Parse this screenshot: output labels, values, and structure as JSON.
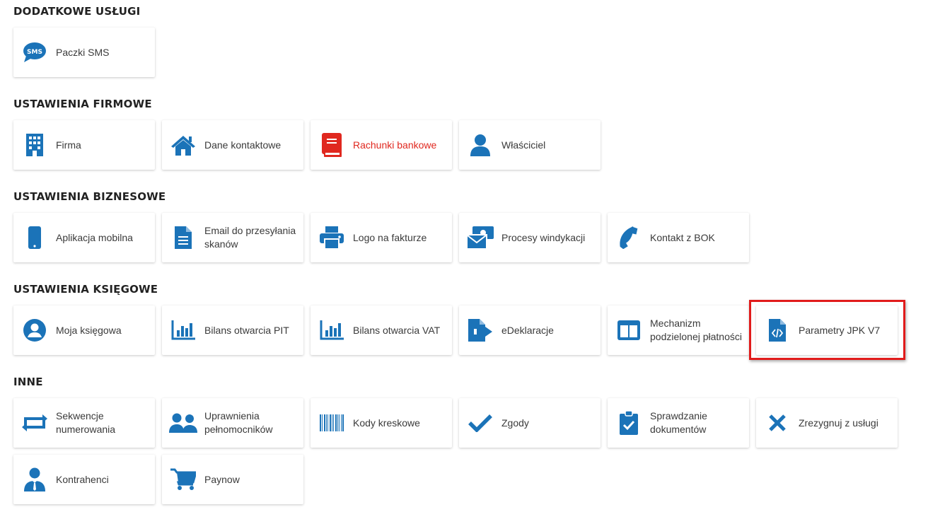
{
  "colors": {
    "icon": "#1b73b8",
    "highlight_label": "#e0281f",
    "highlight_frame": "#e11b1b"
  },
  "sections": {
    "dodatkowe": {
      "title": "DODATKOWE USŁUGI",
      "items": [
        {
          "label": "Paczki SMS",
          "icon": "sms-bubble-icon"
        }
      ]
    },
    "firmowe": {
      "title": "USTAWIENIA FIRMOWE",
      "items": [
        {
          "label": "Firma",
          "icon": "building-icon"
        },
        {
          "label": "Dane kontaktowe",
          "icon": "home-icon"
        },
        {
          "label": "Rachunki bankowe",
          "icon": "bank-book-icon"
        },
        {
          "label": "Właściciel",
          "icon": "user-icon"
        }
      ]
    },
    "biznesowe": {
      "title": "USTAWIENIA BIZNESOWE",
      "items": [
        {
          "label": "Aplikacja mobilna",
          "icon": "mobile-phone-icon"
        },
        {
          "label": "Email do przesyłania skanów",
          "icon": "document-icon"
        },
        {
          "label": "Logo na fakturze",
          "icon": "printer-icon"
        },
        {
          "label": "Procesy windykacji",
          "icon": "money-envelope-icon"
        },
        {
          "label": "Kontakt z BOK",
          "icon": "phone-icon"
        }
      ]
    },
    "ksiegowe": {
      "title": "USTAWIENIA KSIĘGOWE",
      "items": [
        {
          "label": "Moja księgowa",
          "icon": "account-circle-icon"
        },
        {
          "label": "Bilans otwarcia PIT",
          "icon": "bar-chart-icon"
        },
        {
          "label": "Bilans otwarcia VAT",
          "icon": "bar-chart-icon"
        },
        {
          "label": "eDeklaracje",
          "icon": "file-export-icon"
        },
        {
          "label": "Mechanizm podzielonej płatności",
          "icon": "split-columns-icon"
        },
        {
          "label": "Parametry JPK V7",
          "icon": "code-file-icon"
        }
      ]
    },
    "inne": {
      "title": "INNE",
      "items": [
        {
          "label": "Sekwencje numerowania",
          "icon": "swap-arrows-icon"
        },
        {
          "label": "Uprawnienia pełnomocników",
          "icon": "users-icon"
        },
        {
          "label": "Kody kreskowe",
          "icon": "barcode-icon"
        },
        {
          "label": "Zgody",
          "icon": "check-icon"
        },
        {
          "label": "Sprawdzanie dokumentów",
          "icon": "clipboard-check-icon"
        },
        {
          "label": "Zrezygnuj z usługi",
          "icon": "close-icon"
        },
        {
          "label": "Kontrahenci",
          "icon": "business-person-icon"
        },
        {
          "label": "Paynow",
          "icon": "shopping-cart-icon"
        }
      ]
    }
  }
}
